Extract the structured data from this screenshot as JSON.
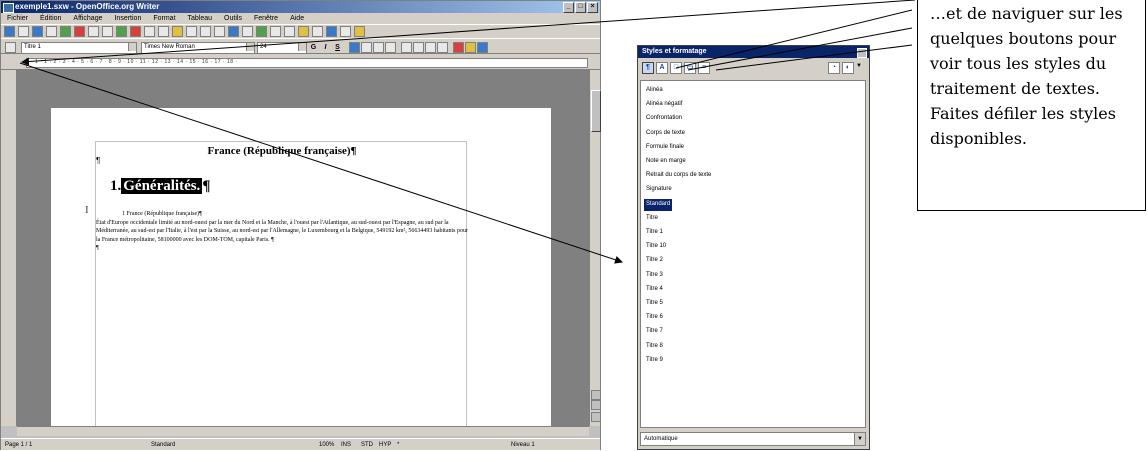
{
  "writer": {
    "title": "exemple1.sxw - OpenOffice.org Writer",
    "menu": [
      "Fichier",
      "Édition",
      "Affichage",
      "Insertion",
      "Format",
      "Tableau",
      "Outils",
      "Fenêtre",
      "Aide"
    ],
    "paragraph_style": "Titre 1",
    "font_name": "Times New Roman",
    "font_size": "24",
    "format_buttons": [
      "G",
      "I",
      "S"
    ],
    "ruler_numbers": "· 1 · 1 · 2 · 3 · 4 · 5 · 6 · 7 · 8 · 9 · 10 · 11 · 12 · 13 · 14 · 15 · 16 · 17 · 18 ·"
  },
  "document": {
    "title": "France (République française)¶",
    "para_mark": "¶",
    "heading_number": "1.",
    "heading_text": "Généralités.",
    "heading_mark": "¶",
    "body_line1": "1    France (République française)¶",
    "body_text": "État d'Europe occidentale limité au nord-ouest par la mer du Nord et la Manche, à l'ouest par l'Atlantique, au sud-ouest par l'Espagne, au sud par la Méditerranée, au sud-est par l'Italie, à l'est par la Suisse, au nord-est par l'Allemagne, le Luxembourg et la Belgique, 549192 km², 56634493 habitants pour la France métropolitaine, 58100000 avec les DOM-TOM, capitale Paris. ¶",
    "body_end": "¶",
    "cursor": "I"
  },
  "status": {
    "page": "Page 1 / 1",
    "style": "Standard",
    "zoom": "100%",
    "mode": "INS",
    "std": "STD",
    "hyp": "HYP",
    "star": "*",
    "level": "Niveau 1"
  },
  "styles_panel": {
    "title": "Styles et formatage",
    "items": [
      "Alinéa",
      "Alinéa négatif",
      "Confrontation",
      "Corps de texte",
      "Formule finale",
      "Note en marge",
      "Retrait du corps de texte",
      "Signature",
      "Standard",
      "Titre",
      "Titre 1",
      "Titre 10",
      "Titre 2",
      "Titre 3",
      "Titre 4",
      "Titre 5",
      "Titre 6",
      "Titre 7",
      "Titre 8",
      "Titre 9"
    ],
    "selected": "Standard",
    "filter": "Automatique"
  },
  "callout": {
    "text": "…et de naviguer sur les quelques boutons pour voir tous les styles du traitement de textes. Faites défiler les styles disponibles."
  },
  "colors": {
    "titlebar": "#0a246a",
    "selection": "#0a246a",
    "window_gray": "#c0c0c0"
  }
}
